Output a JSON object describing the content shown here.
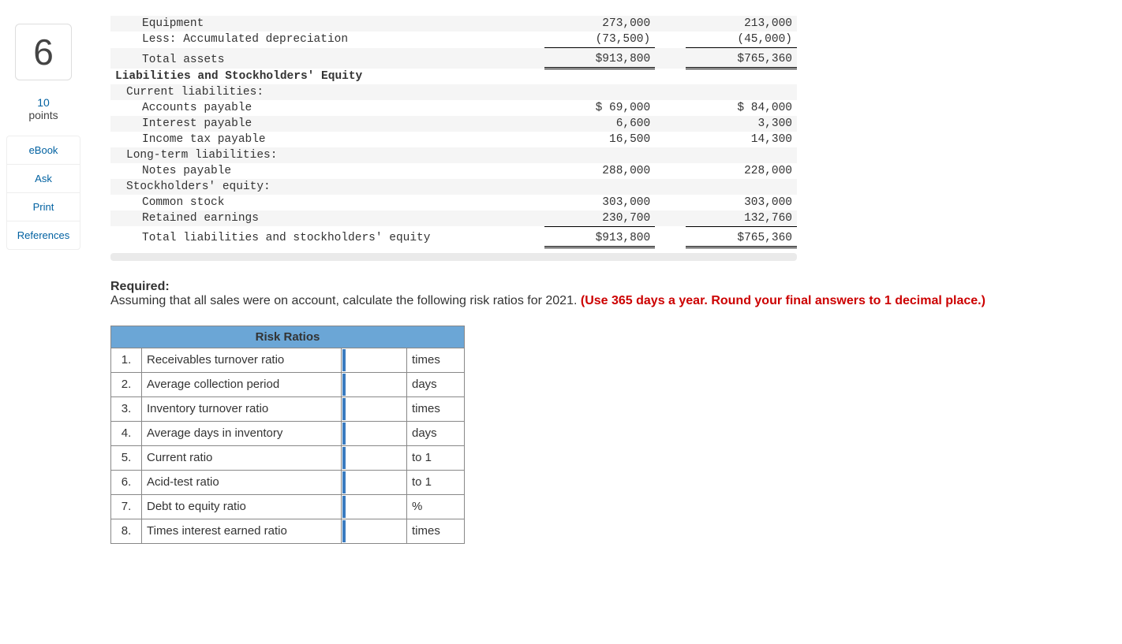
{
  "sidebar": {
    "question_number": "6",
    "points_value": "10",
    "points_label": "points",
    "links": [
      "eBook",
      "Ask",
      "Print",
      "References"
    ]
  },
  "balance_sheet": {
    "rows": [
      {
        "desc": "Equipment",
        "c1": "273,000",
        "c2": "213,000",
        "indent": 2,
        "alt": true
      },
      {
        "desc": "Less: Accumulated depreciation",
        "c1": "(73,500)",
        "c2": "(45,000)",
        "indent": 2,
        "uline": true
      },
      {
        "desc": "Total assets",
        "c1": "$913,800",
        "c2": "$765,360",
        "indent": 2,
        "alt": true,
        "dbl": true,
        "gap": true
      },
      {
        "desc": "Liabilities and Stockholders' Equity",
        "c1": "",
        "c2": "",
        "bold": true
      },
      {
        "desc": "Current liabilities:",
        "c1": "",
        "c2": "",
        "alt": true,
        "indent": 1
      },
      {
        "desc": "Accounts payable",
        "c1": "$ 69,000",
        "c2": "$ 84,000",
        "indent": 2
      },
      {
        "desc": "Interest payable",
        "c1": "6,600",
        "c2": "3,300",
        "indent": 2,
        "alt": true
      },
      {
        "desc": "Income tax payable",
        "c1": "16,500",
        "c2": "14,300",
        "indent": 2
      },
      {
        "desc": "Long-term liabilities:",
        "c1": "",
        "c2": "",
        "alt": true,
        "indent": 1
      },
      {
        "desc": "Notes payable",
        "c1": "288,000",
        "c2": "228,000",
        "indent": 2
      },
      {
        "desc": "Stockholders' equity:",
        "c1": "",
        "c2": "",
        "alt": true,
        "indent": 1
      },
      {
        "desc": "Common stock",
        "c1": "303,000",
        "c2": "303,000",
        "indent": 2
      },
      {
        "desc": "Retained earnings",
        "c1": "230,700",
        "c2": "132,760",
        "indent": 2,
        "alt": true,
        "uline": true
      },
      {
        "desc": "Total liabilities and stockholders' equity",
        "c1": "$913,800",
        "c2": "$765,360",
        "indent": 2,
        "dbl": true,
        "gap": true
      }
    ]
  },
  "required": {
    "heading": "Required:",
    "text_plain": "Assuming that all sales were on account, calculate the following risk ratios for 2021. ",
    "text_red": "(Use 365 days a year. Round your final answers to 1 decimal place.)"
  },
  "ratios": {
    "header": "Risk Ratios",
    "items": [
      {
        "n": "1.",
        "label": "Receivables turnover ratio",
        "unit": "times"
      },
      {
        "n": "2.",
        "label": "Average collection period",
        "unit": "days"
      },
      {
        "n": "3.",
        "label": "Inventory turnover ratio",
        "unit": "times"
      },
      {
        "n": "4.",
        "label": "Average days in inventory",
        "unit": "days"
      },
      {
        "n": "5.",
        "label": "Current ratio",
        "unit": "to 1"
      },
      {
        "n": "6.",
        "label": "Acid-test ratio",
        "unit": "to 1"
      },
      {
        "n": "7.",
        "label": "Debt to equity ratio",
        "unit": "%"
      },
      {
        "n": "8.",
        "label": "Times interest earned ratio",
        "unit": "times"
      }
    ]
  }
}
